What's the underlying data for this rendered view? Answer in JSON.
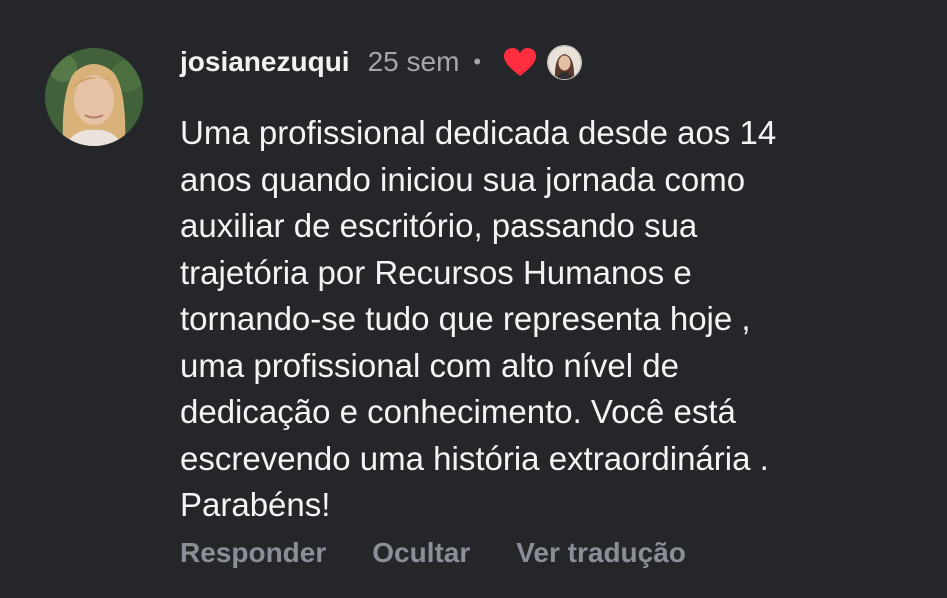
{
  "comment": {
    "username": "josianezuqui",
    "time": "25 sem",
    "separator": "•",
    "text": "Uma profissional dedicada desde aos 14\nanos quando iniciou sua jornada como\nauxiliar de escritório, passando sua\ntrajetória por Recursos Humanos e\ntornando-se tudo que representa hoje ,\numa profissional com alto nível de\ndedicação e conhecimento. Você está\nescrevendo uma história extraordinária .\nParabéns!",
    "icons": {
      "avatar": "user-avatar",
      "like": "heart-icon",
      "liker": "liker-avatar"
    },
    "colors": {
      "background": "#24262a",
      "heart": "#ff2d3d",
      "secondary_text": "#a3a6ad",
      "action_text": "#8a8e96"
    }
  },
  "actions": {
    "reply": "Responder",
    "hide": "Ocultar",
    "translate": "Ver tradução"
  }
}
